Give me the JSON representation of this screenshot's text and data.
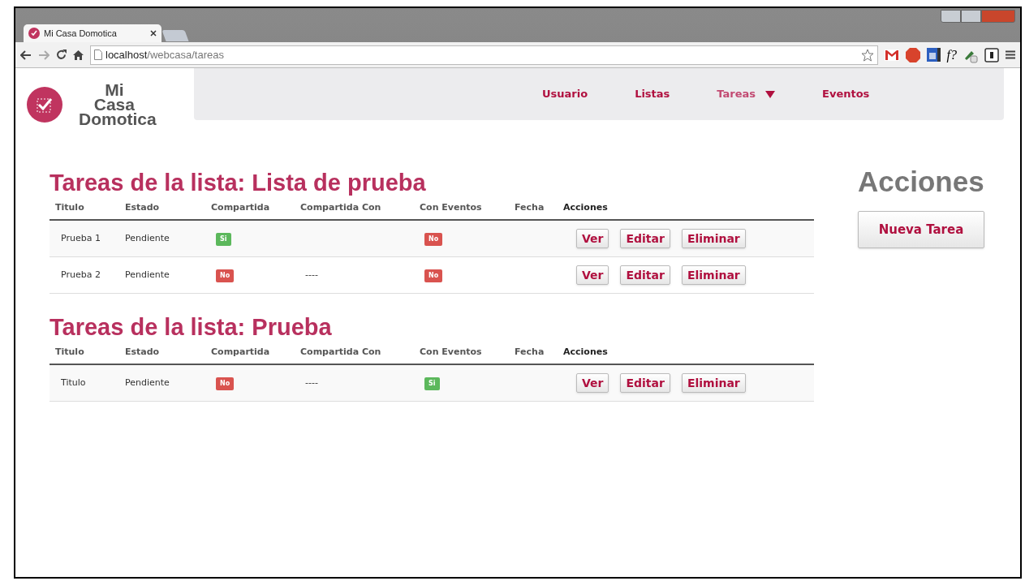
{
  "browser": {
    "tab_title": "Mi Casa Domotica",
    "url_host": "localhost",
    "url_path": "/webcasa/tareas",
    "extension_label": "f?"
  },
  "logo": {
    "lines": [
      "Mi",
      "Casa",
      "Domotica"
    ]
  },
  "nav": [
    {
      "label": "Usuario",
      "selected": false,
      "dropdown": false
    },
    {
      "label": "Listas",
      "selected": false,
      "dropdown": false
    },
    {
      "label": "Tareas",
      "selected": true,
      "dropdown": true
    },
    {
      "label": "Eventos",
      "selected": false,
      "dropdown": false
    }
  ],
  "sections": [
    {
      "title": "Tareas de la lista: Lista de prueba",
      "columns": [
        "Titulo",
        "Estado",
        "Compartida",
        "Compartida Con",
        "Con Eventos",
        "Fecha",
        "Acciones"
      ],
      "rows": [
        {
          "titulo": "Prueba 1",
          "estado": "Pendiente",
          "compartida": {
            "text": "Si",
            "yes": true
          },
          "con_eventos": {
            "text": "No",
            "yes": false
          },
          "actions": [
            "Ver",
            "Editar",
            "Eliminar"
          ]
        },
        {
          "titulo": "Prueba 2",
          "estado": "Pendiente",
          "compartida": {
            "text": "No",
            "yes": false
          },
          "compartida_con": "----",
          "con_eventos": {
            "text": "No",
            "yes": false
          },
          "actions": [
            "Ver",
            "Editar",
            "Eliminar"
          ]
        }
      ]
    },
    {
      "title": "Tareas de la lista: Prueba",
      "columns": [
        "Titulo",
        "Estado",
        "Compartida",
        "Compartida Con",
        "Con Eventos",
        "Fecha",
        "Acciones"
      ],
      "rows": [
        {
          "titulo": "Titulo",
          "estado": "Pendiente",
          "compartida": {
            "text": "No",
            "yes": false
          },
          "compartida_con": "----",
          "con_eventos": {
            "text": "Si",
            "yes": true
          },
          "actions": [
            "Ver",
            "Editar",
            "Eliminar"
          ]
        }
      ]
    }
  ],
  "sidebar": {
    "title": "Acciones",
    "button": "Nueva Tarea"
  }
}
